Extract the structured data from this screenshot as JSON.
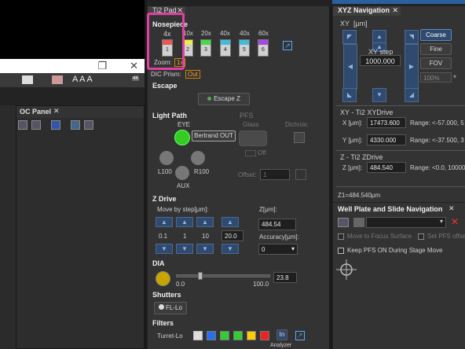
{
  "ti2_pad": {
    "tab_label": "Ti2 Pad",
    "nosepiece": {
      "title": "Nosepiece",
      "current_mag": "4x",
      "zoom_label": "Zoom:",
      "zoom_value": "1x",
      "positions": [
        {
          "mag": "",
          "num": "1"
        },
        {
          "mag": "10x",
          "num": "2"
        },
        {
          "mag": "20x",
          "num": "3"
        },
        {
          "mag": "40x",
          "num": "4"
        },
        {
          "mag": "40x",
          "num": "5"
        },
        {
          "mag": "60x",
          "num": "6"
        }
      ]
    },
    "dic_prism_label": "DIC Prism:",
    "dic_prism_value": "Out",
    "escape": {
      "title": "Escape",
      "button": "Escape Z"
    },
    "light_path": {
      "title": "Light Path",
      "eye": "EYE",
      "bertrand": "Bertrand OUT",
      "l100": "L100",
      "r100": "R100",
      "aux": "AUX",
      "pfs": "PFS",
      "glass": "Glass",
      "off": "Off",
      "dichroic": "Dichroic",
      "offset_label": "Offset:",
      "offset_value": "1"
    },
    "z_drive": {
      "title": "Z Drive",
      "step_label": "Move by step[μm]:",
      "z_label": "Z[μm]:",
      "z_value": "484.54",
      "steps": [
        "0.1",
        "1",
        "10",
        "20.0"
      ],
      "accuracy_label": "Accuracy[μm]:",
      "accuracy_value": "0"
    },
    "dia": {
      "title": "DIA",
      "min": "0.0",
      "max": "100.0",
      "value": "23.8",
      "fraction": 0.238
    },
    "shutters": {
      "title": "Shutters",
      "button": "FL-Lo"
    },
    "filters": {
      "title": "Filters",
      "turret": "Turret-Lo",
      "in_button": "In",
      "analyzer": "Analyzer"
    }
  },
  "xyz_navigation": {
    "tab_label": "XYZ Navigation",
    "xy_label": "XY",
    "unit": "[μm]",
    "coarse": "Coarse",
    "fine": "Fine",
    "fov": "FOV",
    "xy_step_label": "XY step",
    "xy_step_value": "1000.000",
    "zoom_pct": "100%",
    "xy_drive_title": "XY - Ti2 XYDrive",
    "x_label": "X [μm]:",
    "x_value": "17473.600",
    "x_range": "Range:  <-57.000, 5",
    "y_label": "Y [μm]:",
    "y_value": "4330.000",
    "y_range": "Range:  <-37.500, 3",
    "z_drive_title": "Z - Ti2 ZDrive",
    "z_label": "Z [μm]:",
    "z_value": "484.540",
    "z_range": "Range:  <0.0, 10000",
    "z_status": "Z1=484.540μm"
  },
  "well_plate": {
    "title": "Well Plate and Slide Navigation",
    "move_focus": "Move to Focus Surface",
    "set_pfs": "Set PFS offse",
    "keep_pfs": "Keep PFS ON During Stage Move"
  },
  "oc_panel": {
    "title": "OC Panel"
  },
  "window": {
    "restore": "❐",
    "close": "✕"
  },
  "colors": {
    "accent_blue": "#2f4a6e",
    "highlight": "#e040a0",
    "eye_green": "#33cc22",
    "dia_lamp": "#c8a400"
  }
}
